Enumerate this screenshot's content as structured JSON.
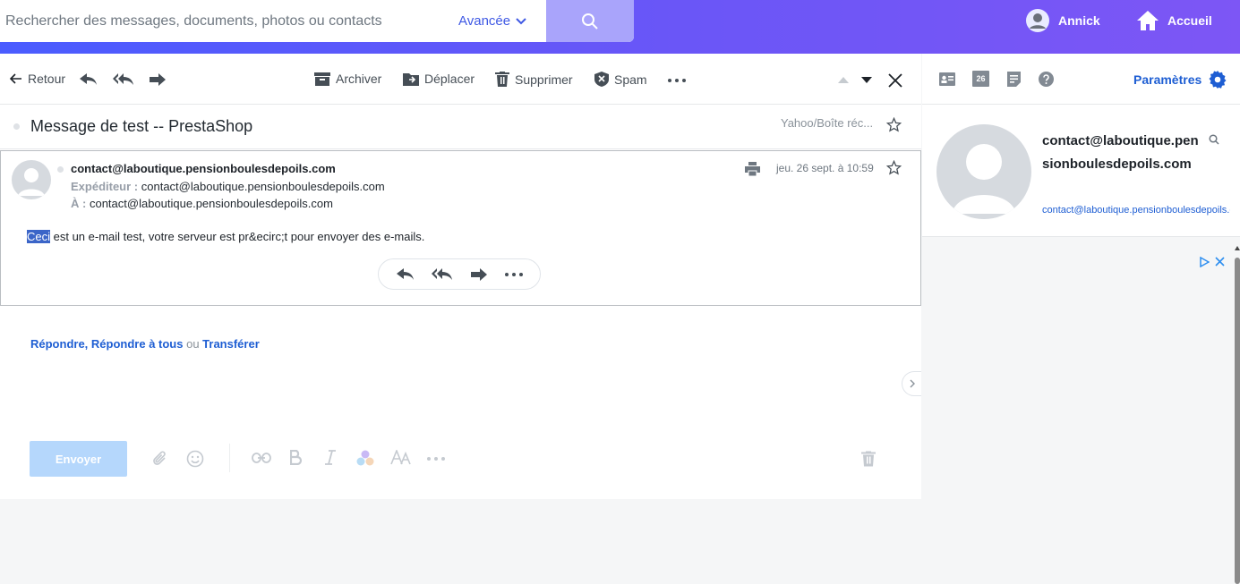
{
  "search": {
    "placeholder": "Rechercher des messages, documents, photos ou contacts",
    "advanced_label": "Avancée"
  },
  "header": {
    "user_name": "Annick",
    "home_label": "Accueil"
  },
  "toolbar": {
    "back_label": "Retour",
    "archive_label": "Archiver",
    "move_label": "Déplacer",
    "delete_label": "Supprimer",
    "spam_label": "Spam"
  },
  "message": {
    "subject": "Message de test -- PrestaShop",
    "folder": "Yahoo/Boîte réc...",
    "from_name": "contact@laboutique.pensionboulesdepoils.com",
    "sender_label": "Expéditeur :",
    "sender_value": "contact@laboutique.pensionboulesdepoils.com",
    "to_label": "À :",
    "to_value": "contact@laboutique.pensionboulesdepoils.com",
    "date": "jeu. 26 sept. à 10:59",
    "body_selected": "Ceci",
    "body_rest": " est un e-mail test, votre serveur est pr&ecirc;t pour envoyer des e-mails."
  },
  "reply": {
    "reply_label": "Répondre",
    "comma": ", ",
    "reply_all_label": "Répondre à tous",
    "or_label": " ou ",
    "forward_label": "Transférer",
    "send_label": "Envoyer"
  },
  "right_panel": {
    "settings_label": "Paramètres",
    "calendar_day": "26",
    "contact_name": "contact@laboutique.pensionboulesdepoils.com",
    "contact_email": "contact@laboutique.pensionboulesdepoils.com"
  },
  "icons": [
    "search-icon",
    "chevron-down-icon",
    "user-icon",
    "home-icon",
    "back-arrow-icon",
    "reply-icon",
    "reply-all-icon",
    "forward-icon",
    "archive-icon",
    "move-icon",
    "trash-icon",
    "shield-icon",
    "more-icon",
    "up-icon",
    "down-icon",
    "close-icon",
    "star-icon",
    "print-icon",
    "attach-icon",
    "emoji-icon",
    "link-icon",
    "bold-icon",
    "italic-icon",
    "color-icon",
    "font-size-icon",
    "contact-card-icon",
    "calendar-icon",
    "notepad-icon",
    "help-icon",
    "gear-icon",
    "adchoices-icon"
  ],
  "colors": {
    "accent": "#1e5ed3",
    "topbar_start": "#4a5cff",
    "topbar_end": "#7d56f5",
    "send_disabled": "#b5d7fc",
    "selection": "#3b65c8"
  }
}
